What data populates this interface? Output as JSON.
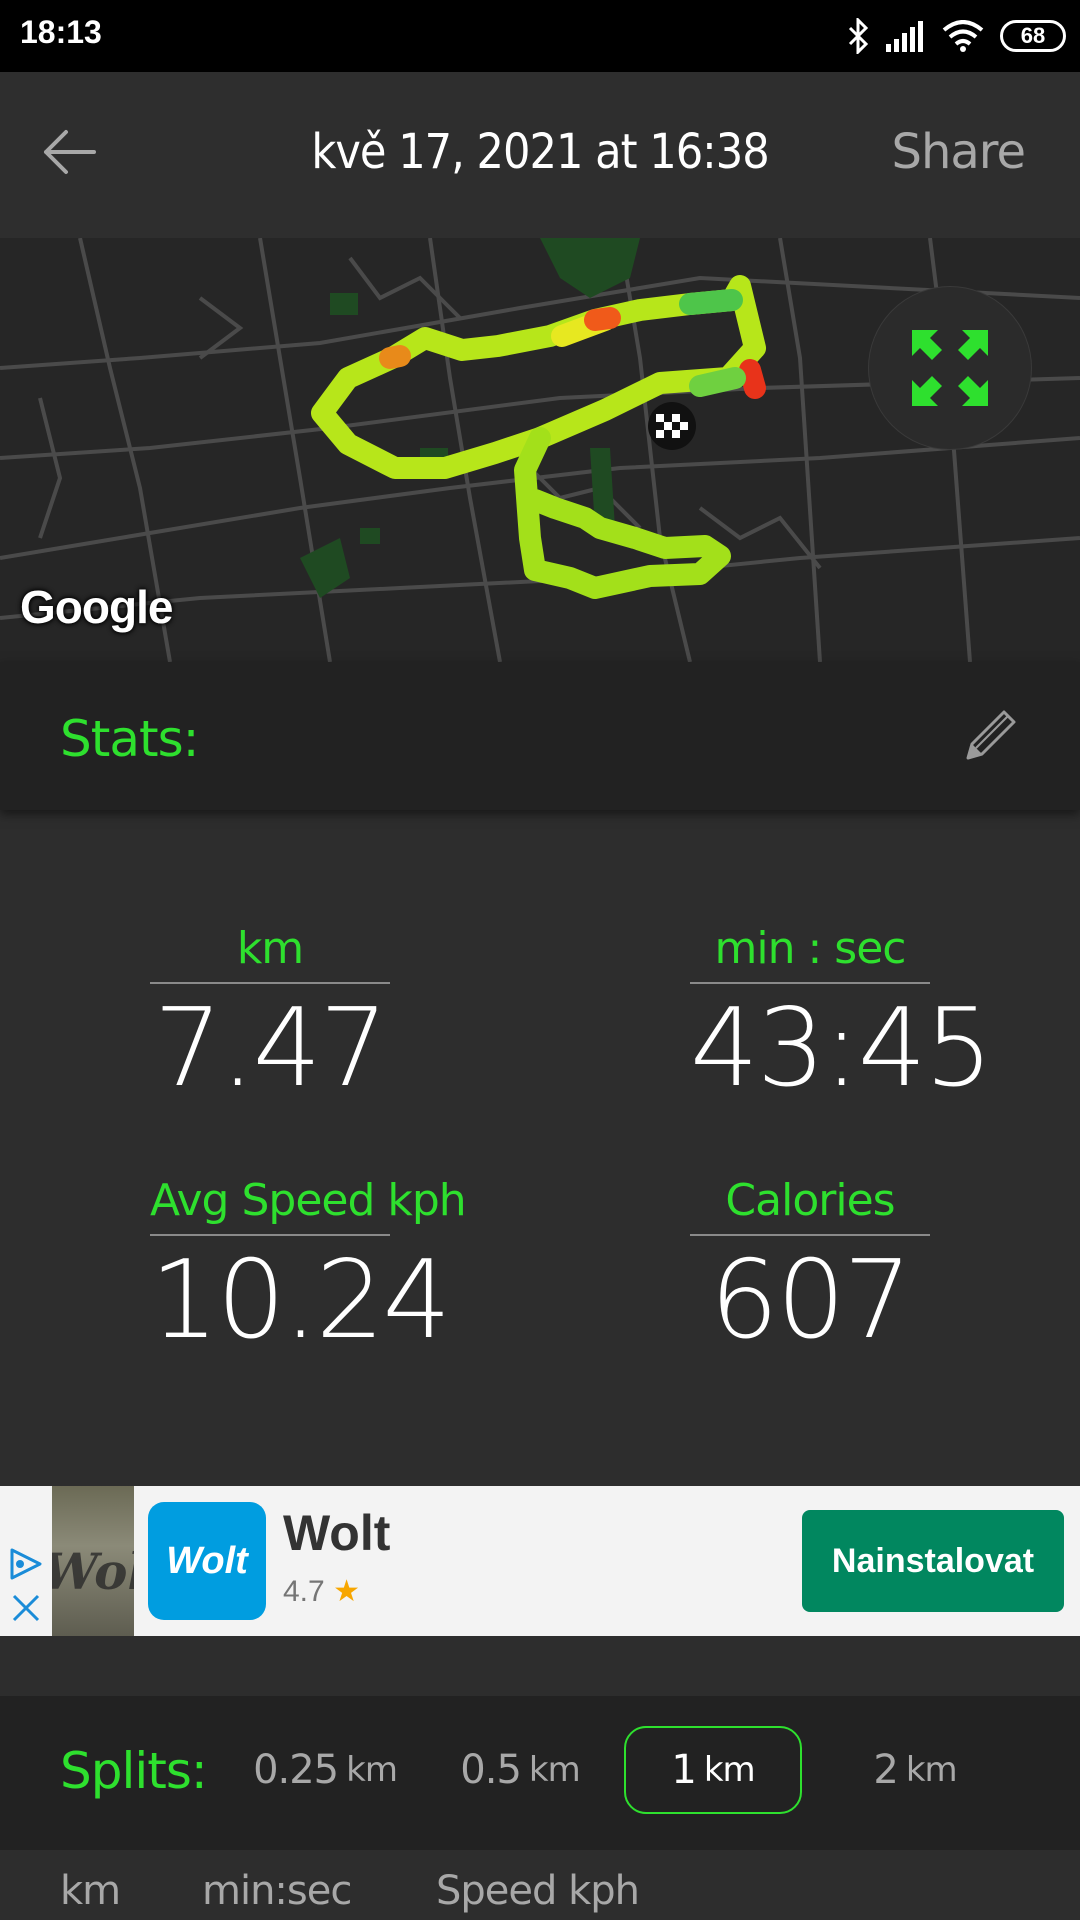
{
  "status_bar": {
    "time": "18:13",
    "battery": "68",
    "icons": [
      "bluetooth-icon",
      "signal-icon",
      "wifi-icon",
      "battery-icon"
    ]
  },
  "header": {
    "title": "kvě 17, 2021 at 16:38",
    "share_label": "Share",
    "back_icon": "arrow-left-icon"
  },
  "map": {
    "attribution": "Google",
    "expand_icon": "expand-arrows-icon"
  },
  "stats": {
    "section_label": "Stats:",
    "edit_icon": "pencil-icon",
    "items": [
      {
        "label": "km",
        "value": "7.47"
      },
      {
        "label": "min : sec",
        "value": "43:45"
      },
      {
        "label": "Avg Speed kph",
        "value": "10.24"
      },
      {
        "label": "Calories",
        "value": "607"
      }
    ]
  },
  "ad": {
    "app_name": "Wolt",
    "app_icon_text": "Wolt",
    "thumb_text": "Wolt",
    "rating": "4.7",
    "star": "★",
    "install_label": "Nainstalovat"
  },
  "splits": {
    "section_label": "Splits:",
    "options": [
      {
        "num": "0.25",
        "unit": "km"
      },
      {
        "num": "0.5",
        "unit": "km"
      },
      {
        "num": "1",
        "unit": "km"
      },
      {
        "num": "2",
        "unit": "km"
      }
    ],
    "selected": "1 km",
    "columns": [
      "km",
      "min:sec",
      "Speed kph"
    ]
  },
  "colors": {
    "accent": "#2ee02e",
    "ad_button": "#01875f",
    "wolt_blue": "#009de0"
  }
}
